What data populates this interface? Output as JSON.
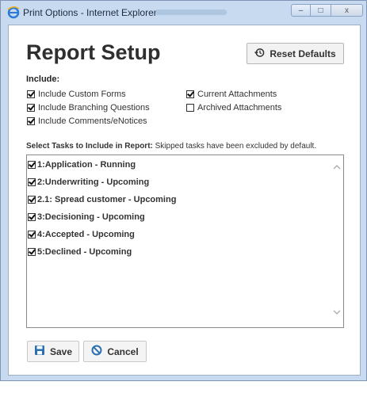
{
  "window": {
    "title": "Print Options - Internet Explorer",
    "controls": [
      "–",
      "□",
      "x"
    ]
  },
  "dialog": {
    "heading": "Report Setup",
    "reset_label": "Reset Defaults",
    "include_label": "Include:",
    "options_left": [
      {
        "label": "Include Custom Forms",
        "checked": true
      },
      {
        "label": "Include Branching Questions",
        "checked": true
      },
      {
        "label": "Include Comments/eNotices",
        "checked": true
      }
    ],
    "options_right": [
      {
        "label": "Current Attachments",
        "checked": true
      },
      {
        "label": "Archived Attachments",
        "checked": false
      }
    ],
    "tasks_label_bold": "Select Tasks to Include in Report:",
    "tasks_label_note": "Skipped tasks have been excluded by default.",
    "tasks": [
      {
        "label": "1:Application - Running",
        "checked": true
      },
      {
        "label": "2:Underwriting - Upcoming",
        "checked": true
      },
      {
        "label": "2.1: Spread customer - Upcoming",
        "checked": true
      },
      {
        "label": "3:Decisioning - Upcoming",
        "checked": true
      },
      {
        "label": "4:Accepted - Upcoming",
        "checked": true
      },
      {
        "label": "5:Declined - Upcoming",
        "checked": true
      }
    ],
    "save_label": "Save",
    "cancel_label": "Cancel"
  },
  "colors": {
    "window_frame": "#c7daf0",
    "save_icon": "#2a6fb0",
    "cancel_icon": "#2a6fb0"
  }
}
